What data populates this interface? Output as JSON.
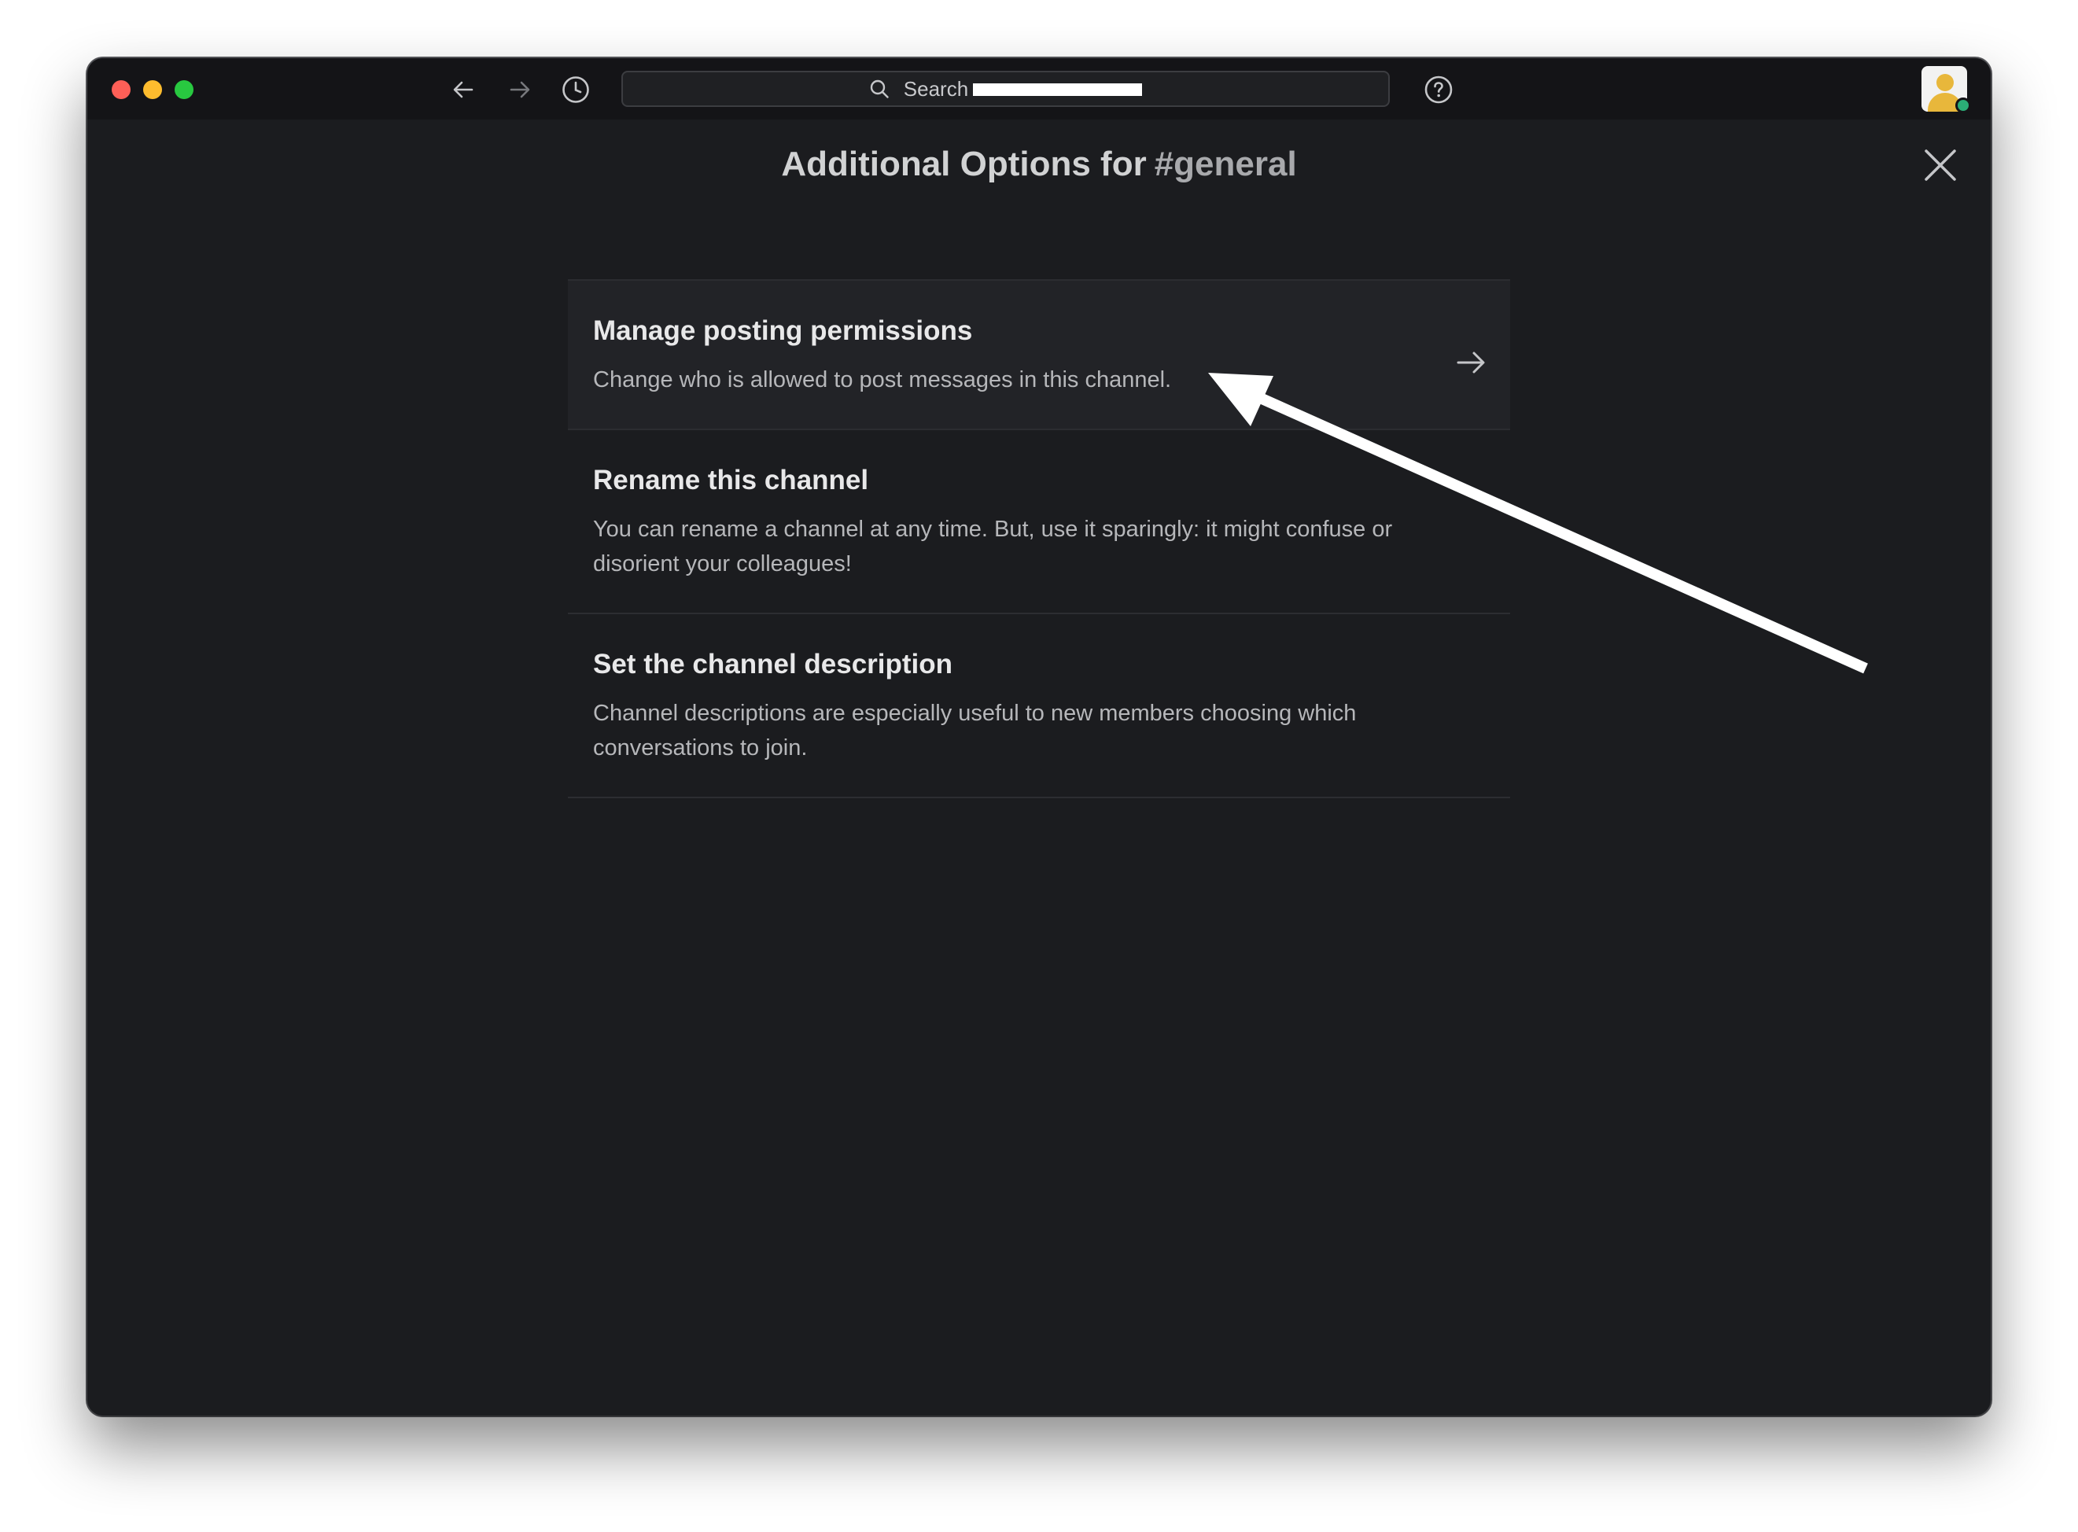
{
  "search": {
    "label": "Search"
  },
  "modal": {
    "title": "Additional Options for",
    "channel": "#general"
  },
  "options": [
    {
      "title": "Manage posting permissions",
      "description": "Change who is allowed to post messages in this channel."
    },
    {
      "title": "Rename this channel",
      "description": "You can rename a channel at any time. But, use it sparingly: it might confuse or disorient your colleagues!"
    },
    {
      "title": "Set the channel description",
      "description": "Channel descriptions are especially useful to new members choosing which conversations to join."
    }
  ],
  "icons": {
    "back": "arrow-left-icon",
    "forward": "arrow-right-icon",
    "history": "clock-icon",
    "search": "search-icon",
    "help": "question-circle-icon",
    "close": "close-icon",
    "option_arrow": "arrow-right-icon"
  },
  "colors": {
    "window_bg": "#1b1c1f",
    "titlebar_bg": "#141417",
    "highlight_row": "#222327",
    "presence": "#2bac76",
    "traffic_red": "#fe5f57",
    "traffic_yellow": "#febc2e",
    "traffic_green": "#28c840"
  }
}
